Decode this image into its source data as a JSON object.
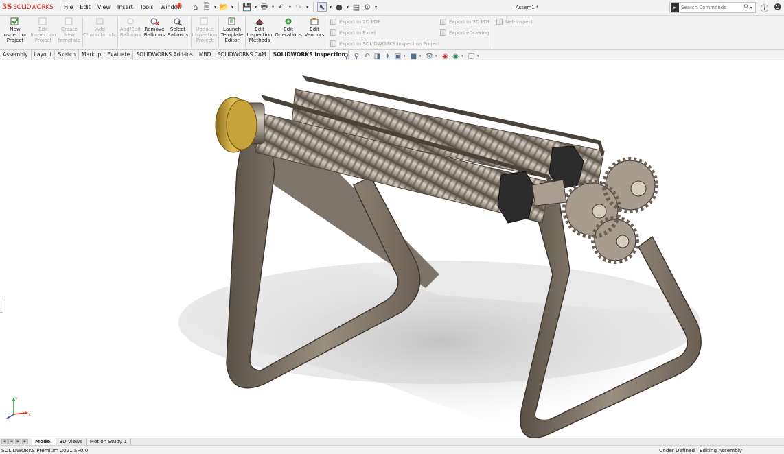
{
  "app": {
    "brand": "SOLIDWORKS",
    "document_title": "Assem1 *"
  },
  "menu": [
    "File",
    "Edit",
    "View",
    "Insert",
    "Tools",
    "Window"
  ],
  "search": {
    "placeholder": "Search Commands"
  },
  "ribbon": {
    "buttons": [
      {
        "label": "New\nInspection\nProject",
        "enabled": true
      },
      {
        "label": "Edit\nInspection\nProject",
        "enabled": false
      },
      {
        "label": "Create\nNew\ntemplate",
        "enabled": false
      },
      {
        "label": "Add\nCharacteristic",
        "enabled": false
      },
      {
        "label": "Add/Edit\nBalloons",
        "enabled": false
      },
      {
        "label": "Remove\nBalloons",
        "enabled": true
      },
      {
        "label": "Select\nBalloons",
        "enabled": true
      },
      {
        "label": "Update\nInspection\nProject",
        "enabled": false
      },
      {
        "label": "Launch\nTemplate\nEditor",
        "enabled": true
      },
      {
        "label": "Edit\nInspection\nMethods",
        "enabled": true
      },
      {
        "label": "Edit\nOperations",
        "enabled": true
      },
      {
        "label": "Edit\nVendors",
        "enabled": true
      }
    ],
    "export": {
      "pdf2d": "Export to 2D PDF",
      "excel": "Export to Excel",
      "project": "Export to SOLIDWORKS Inspection Project",
      "pdf3d": "Export to 3D PDF",
      "edrawing": "Export eDrawing",
      "netinspect": "Net-Inspect"
    }
  },
  "tabs": [
    {
      "label": "Assembly",
      "active": false
    },
    {
      "label": "Layout",
      "active": false
    },
    {
      "label": "Sketch",
      "active": false
    },
    {
      "label": "Markup",
      "active": false
    },
    {
      "label": "Evaluate",
      "active": false
    },
    {
      "label": "SOLIDWORKS Add-Ins",
      "active": false
    },
    {
      "label": "MBD",
      "active": false
    },
    {
      "label": "SOLIDWORKS CAM",
      "active": false
    },
    {
      "label": "SOLIDWORKS Inspection",
      "active": true
    }
  ],
  "bottom_tabs": [
    {
      "label": "Model",
      "active": true
    },
    {
      "label": "3D Views",
      "active": false
    },
    {
      "label": "Motion Study 1",
      "active": false
    }
  ],
  "status": {
    "version": "SOLIDWORKS Premium 2021 SP0.0",
    "definition": "Under Defined",
    "mode": "Editing Assembly"
  },
  "icons": {
    "home": "home-icon",
    "new": "new-document-icon",
    "open": "open-icon",
    "save": "save-icon",
    "print": "print-icon",
    "undo": "undo-icon",
    "redo": "redo-icon",
    "select": "select-pointer-icon",
    "rebuild": "traffic-light-icon",
    "file_props": "file-properties-icon",
    "options": "gear-icon",
    "help": "help-icon",
    "user": "user-icon"
  },
  "colors": {
    "brand_red": "#d4261c",
    "viewport_bg": "#ffffff",
    "model_metal": "#8f8577",
    "brass": "#c8a23a"
  }
}
